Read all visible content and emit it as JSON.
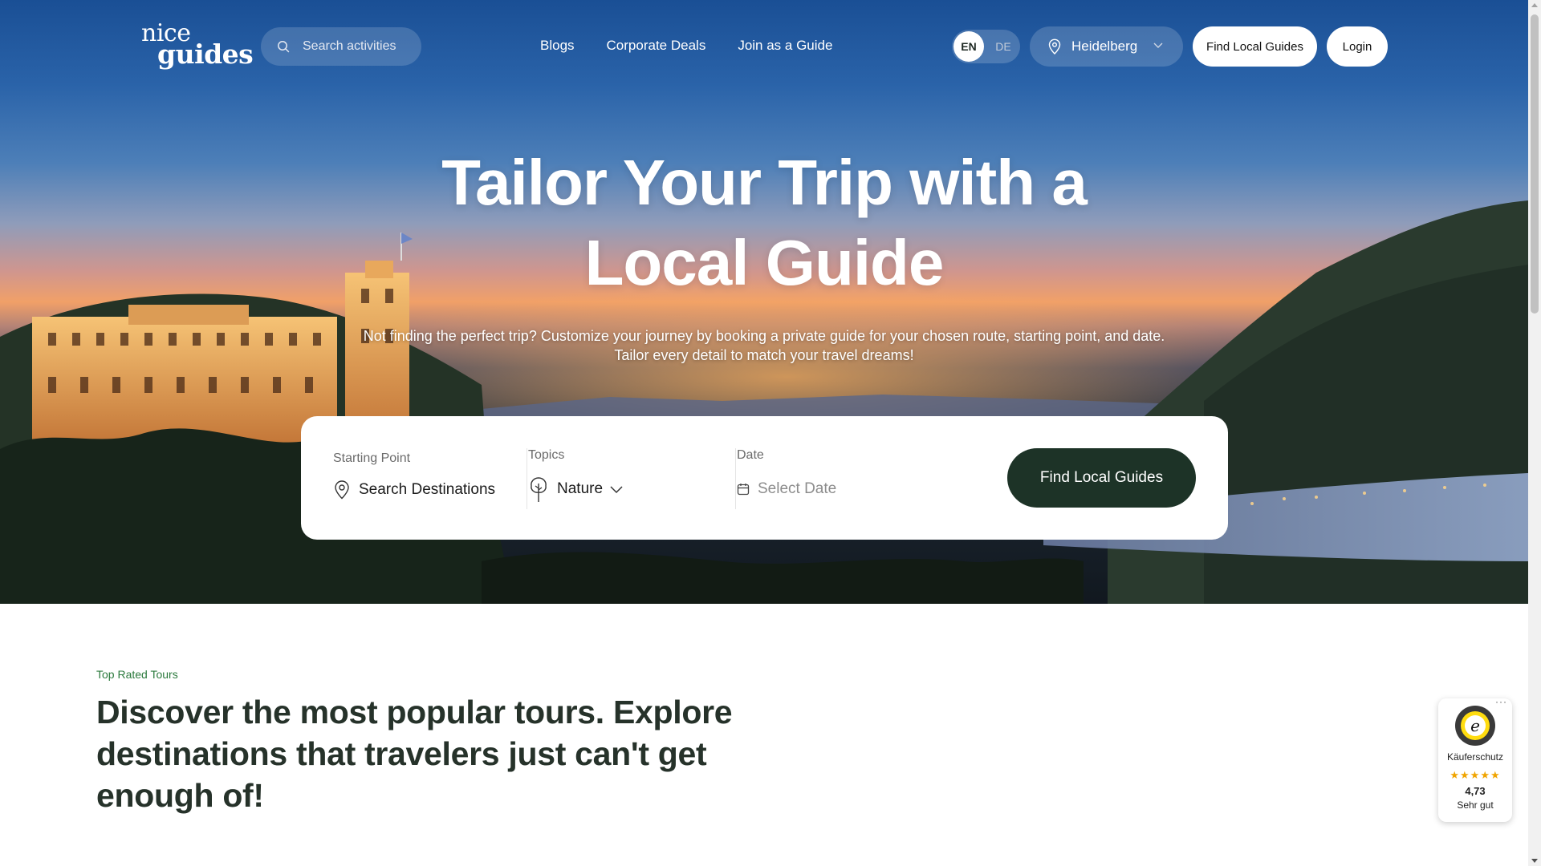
{
  "brand": {
    "logo_line1": "nice",
    "logo_line2": "guides"
  },
  "header": {
    "search_placeholder": "Search activities",
    "nav_links": [
      "Blogs",
      "Corporate Deals",
      "Join as a Guide"
    ],
    "lang_active": "EN",
    "lang_inactive": "DE",
    "city": "Heidelberg",
    "find_button": "Find Local Guides",
    "login_button": "Login"
  },
  "hero": {
    "title": "Tailor Your Trip with a Local Guide",
    "subtitle": "Not finding the perfect trip? Customize your journey by booking a private guide for your chosen route, starting point, and date. Tailor every detail to match your travel dreams!"
  },
  "search_card": {
    "starting_point_label": "Starting Point",
    "starting_point_value": "Search Destinations",
    "topics_label": "Topics",
    "topics_value": "Nature",
    "date_label": "Date",
    "date_placeholder": "Select Date",
    "submit_button": "Find Local Guides"
  },
  "section": {
    "eyebrow": "Top Rated Tours",
    "title": "Discover the most popular tours. Explore destinations that travelers just can't get enough of!"
  },
  "trust_badge": {
    "label": "Käuferschutz",
    "rating": "4,73",
    "rating_text": "Sehr gut",
    "stars_value": 4.73,
    "stars_max": 5
  },
  "colors": {
    "accent_dark_green": "#1d3327",
    "eyebrow_green": "#2b7a3d",
    "star_color": "#f0a400"
  }
}
